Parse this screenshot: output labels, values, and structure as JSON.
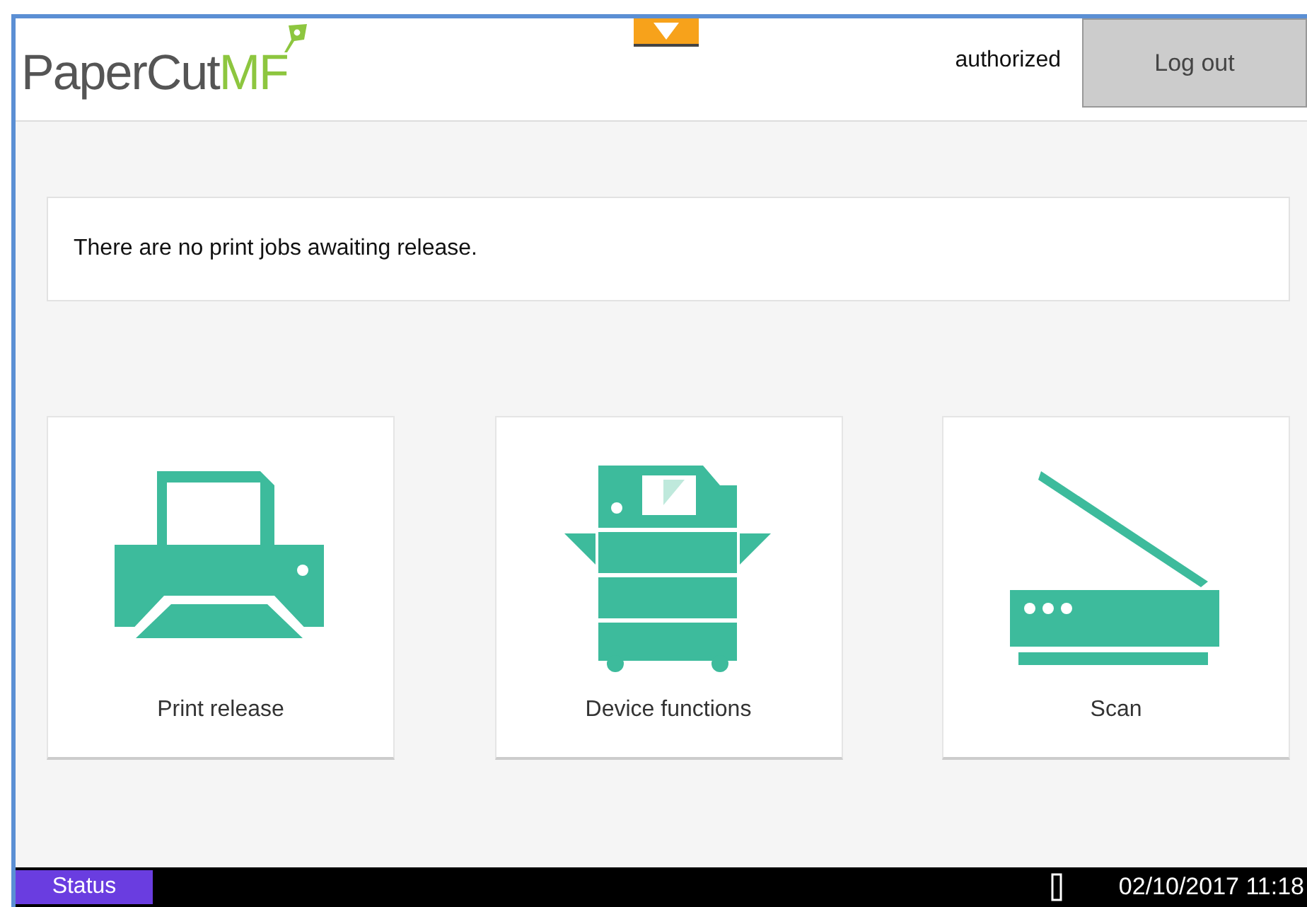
{
  "header": {
    "logo_main": "PaperCut",
    "logo_suffix": "MF",
    "user": "authorized",
    "logout": "Log out"
  },
  "message": "There are no print jobs awaiting release.",
  "tiles": [
    {
      "kind": "printer",
      "label": "Print release"
    },
    {
      "kind": "copier",
      "label": "Device functions"
    },
    {
      "kind": "scanner",
      "label": "Scan"
    }
  ],
  "status_bar": {
    "status": "Status",
    "datetime": "02/10/2017 11:18"
  }
}
